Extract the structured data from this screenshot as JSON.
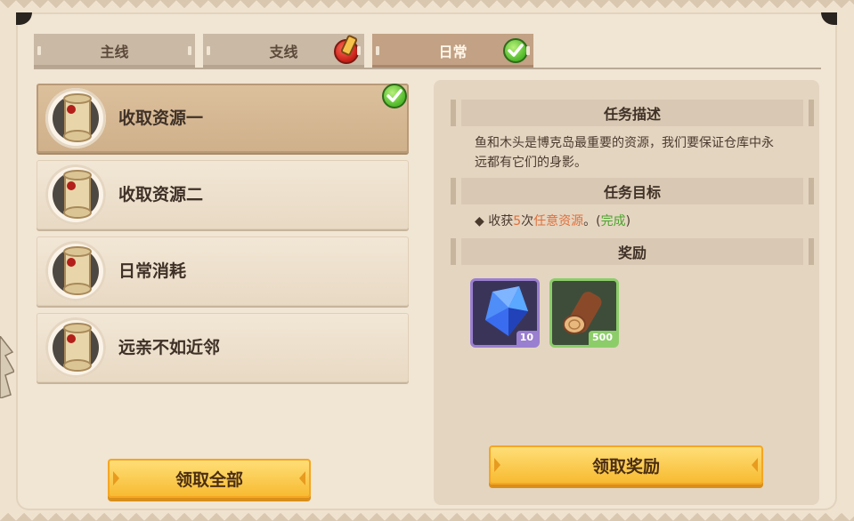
{
  "tabs": [
    {
      "label": "主线",
      "active": false,
      "badge": null
    },
    {
      "label": "支线",
      "active": false,
      "badge": "alert-icon"
    },
    {
      "label": "日常",
      "active": true,
      "badge": "check-icon"
    }
  ],
  "quests": [
    {
      "label": "收取资源一",
      "selected": true,
      "completed": true,
      "icon": "scroll-icon"
    },
    {
      "label": "收取资源二",
      "selected": false,
      "completed": false,
      "icon": "scroll-icon"
    },
    {
      "label": "日常消耗",
      "selected": false,
      "completed": false,
      "icon": "scroll-icon"
    },
    {
      "label": "远亲不如近邻",
      "selected": false,
      "completed": false,
      "icon": "scroll-icon"
    }
  ],
  "detail": {
    "desc_title": "任务描述",
    "desc_text": "鱼和木头是博克岛最重要的资源，我们要保证仓库中永远都有它们的身影。",
    "goal_title": "任务目标",
    "goal": {
      "bullet": "◆",
      "prefix": "收获",
      "count": "5",
      "unit": "次",
      "target": "任意资源",
      "punct": "。(",
      "status": "完成",
      "close": ")"
    },
    "reward_title": "奖励",
    "rewards": [
      {
        "icon": "blue-gem-icon",
        "count": "10"
      },
      {
        "icon": "wood-log-icon",
        "count": "500"
      }
    ]
  },
  "buttons": {
    "claim_all": "领取全部",
    "claim_reward": "领取奖励"
  },
  "colors": {
    "accent_orange": "#e0703a",
    "complete_green": "#4aa52b",
    "button_yellow": "#f7b92e"
  }
}
